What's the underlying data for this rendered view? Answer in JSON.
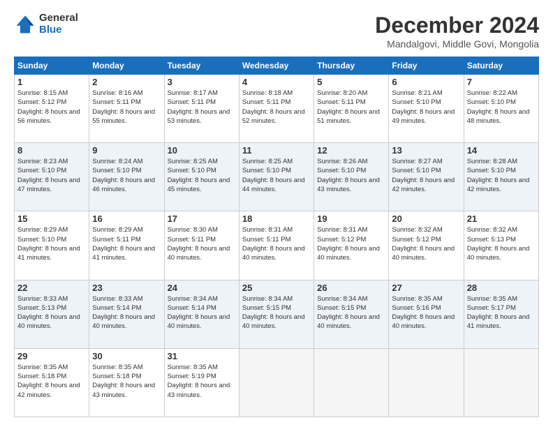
{
  "logo": {
    "general": "General",
    "blue": "Blue"
  },
  "title": "December 2024",
  "subtitle": "Mandalgovi, Middle Govi, Mongolia",
  "headers": [
    "Sunday",
    "Monday",
    "Tuesday",
    "Wednesday",
    "Thursday",
    "Friday",
    "Saturday"
  ],
  "weeks": [
    [
      {
        "day": "1",
        "sunrise": "8:15 AM",
        "sunset": "5:12 PM",
        "daylight": "8 hours and 56 minutes."
      },
      {
        "day": "2",
        "sunrise": "8:16 AM",
        "sunset": "5:11 PM",
        "daylight": "8 hours and 55 minutes."
      },
      {
        "day": "3",
        "sunrise": "8:17 AM",
        "sunset": "5:11 PM",
        "daylight": "8 hours and 53 minutes."
      },
      {
        "day": "4",
        "sunrise": "8:18 AM",
        "sunset": "5:11 PM",
        "daylight": "8 hours and 52 minutes."
      },
      {
        "day": "5",
        "sunrise": "8:20 AM",
        "sunset": "5:11 PM",
        "daylight": "8 hours and 51 minutes."
      },
      {
        "day": "6",
        "sunrise": "8:21 AM",
        "sunset": "5:10 PM",
        "daylight": "8 hours and 49 minutes."
      },
      {
        "day": "7",
        "sunrise": "8:22 AM",
        "sunset": "5:10 PM",
        "daylight": "8 hours and 48 minutes."
      }
    ],
    [
      {
        "day": "8",
        "sunrise": "8:23 AM",
        "sunset": "5:10 PM",
        "daylight": "8 hours and 47 minutes."
      },
      {
        "day": "9",
        "sunrise": "8:24 AM",
        "sunset": "5:10 PM",
        "daylight": "8 hours and 46 minutes."
      },
      {
        "day": "10",
        "sunrise": "8:25 AM",
        "sunset": "5:10 PM",
        "daylight": "8 hours and 45 minutes."
      },
      {
        "day": "11",
        "sunrise": "8:25 AM",
        "sunset": "5:10 PM",
        "daylight": "8 hours and 44 minutes."
      },
      {
        "day": "12",
        "sunrise": "8:26 AM",
        "sunset": "5:10 PM",
        "daylight": "8 hours and 43 minutes."
      },
      {
        "day": "13",
        "sunrise": "8:27 AM",
        "sunset": "5:10 PM",
        "daylight": "8 hours and 42 minutes."
      },
      {
        "day": "14",
        "sunrise": "8:28 AM",
        "sunset": "5:10 PM",
        "daylight": "8 hours and 42 minutes."
      }
    ],
    [
      {
        "day": "15",
        "sunrise": "8:29 AM",
        "sunset": "5:10 PM",
        "daylight": "8 hours and 41 minutes."
      },
      {
        "day": "16",
        "sunrise": "8:29 AM",
        "sunset": "5:11 PM",
        "daylight": "8 hours and 41 minutes."
      },
      {
        "day": "17",
        "sunrise": "8:30 AM",
        "sunset": "5:11 PM",
        "daylight": "8 hours and 40 minutes."
      },
      {
        "day": "18",
        "sunrise": "8:31 AM",
        "sunset": "5:11 PM",
        "daylight": "8 hours and 40 minutes."
      },
      {
        "day": "19",
        "sunrise": "8:31 AM",
        "sunset": "5:12 PM",
        "daylight": "8 hours and 40 minutes."
      },
      {
        "day": "20",
        "sunrise": "8:32 AM",
        "sunset": "5:12 PM",
        "daylight": "8 hours and 40 minutes."
      },
      {
        "day": "21",
        "sunrise": "8:32 AM",
        "sunset": "5:13 PM",
        "daylight": "8 hours and 40 minutes."
      }
    ],
    [
      {
        "day": "22",
        "sunrise": "8:33 AM",
        "sunset": "5:13 PM",
        "daylight": "8 hours and 40 minutes."
      },
      {
        "day": "23",
        "sunrise": "8:33 AM",
        "sunset": "5:14 PM",
        "daylight": "8 hours and 40 minutes."
      },
      {
        "day": "24",
        "sunrise": "8:34 AM",
        "sunset": "5:14 PM",
        "daylight": "8 hours and 40 minutes."
      },
      {
        "day": "25",
        "sunrise": "8:34 AM",
        "sunset": "5:15 PM",
        "daylight": "8 hours and 40 minutes."
      },
      {
        "day": "26",
        "sunrise": "8:34 AM",
        "sunset": "5:15 PM",
        "daylight": "8 hours and 40 minutes."
      },
      {
        "day": "27",
        "sunrise": "8:35 AM",
        "sunset": "5:16 PM",
        "daylight": "8 hours and 40 minutes."
      },
      {
        "day": "28",
        "sunrise": "8:35 AM",
        "sunset": "5:17 PM",
        "daylight": "8 hours and 41 minutes."
      }
    ],
    [
      {
        "day": "29",
        "sunrise": "8:35 AM",
        "sunset": "5:18 PM",
        "daylight": "8 hours and 42 minutes."
      },
      {
        "day": "30",
        "sunrise": "8:35 AM",
        "sunset": "5:18 PM",
        "daylight": "8 hours and 43 minutes."
      },
      {
        "day": "31",
        "sunrise": "8:35 AM",
        "sunset": "5:19 PM",
        "daylight": "8 hours and 43 minutes."
      },
      null,
      null,
      null,
      null
    ]
  ],
  "labels": {
    "sunrise": "Sunrise: ",
    "sunset": "Sunset: ",
    "daylight": "Daylight: "
  }
}
